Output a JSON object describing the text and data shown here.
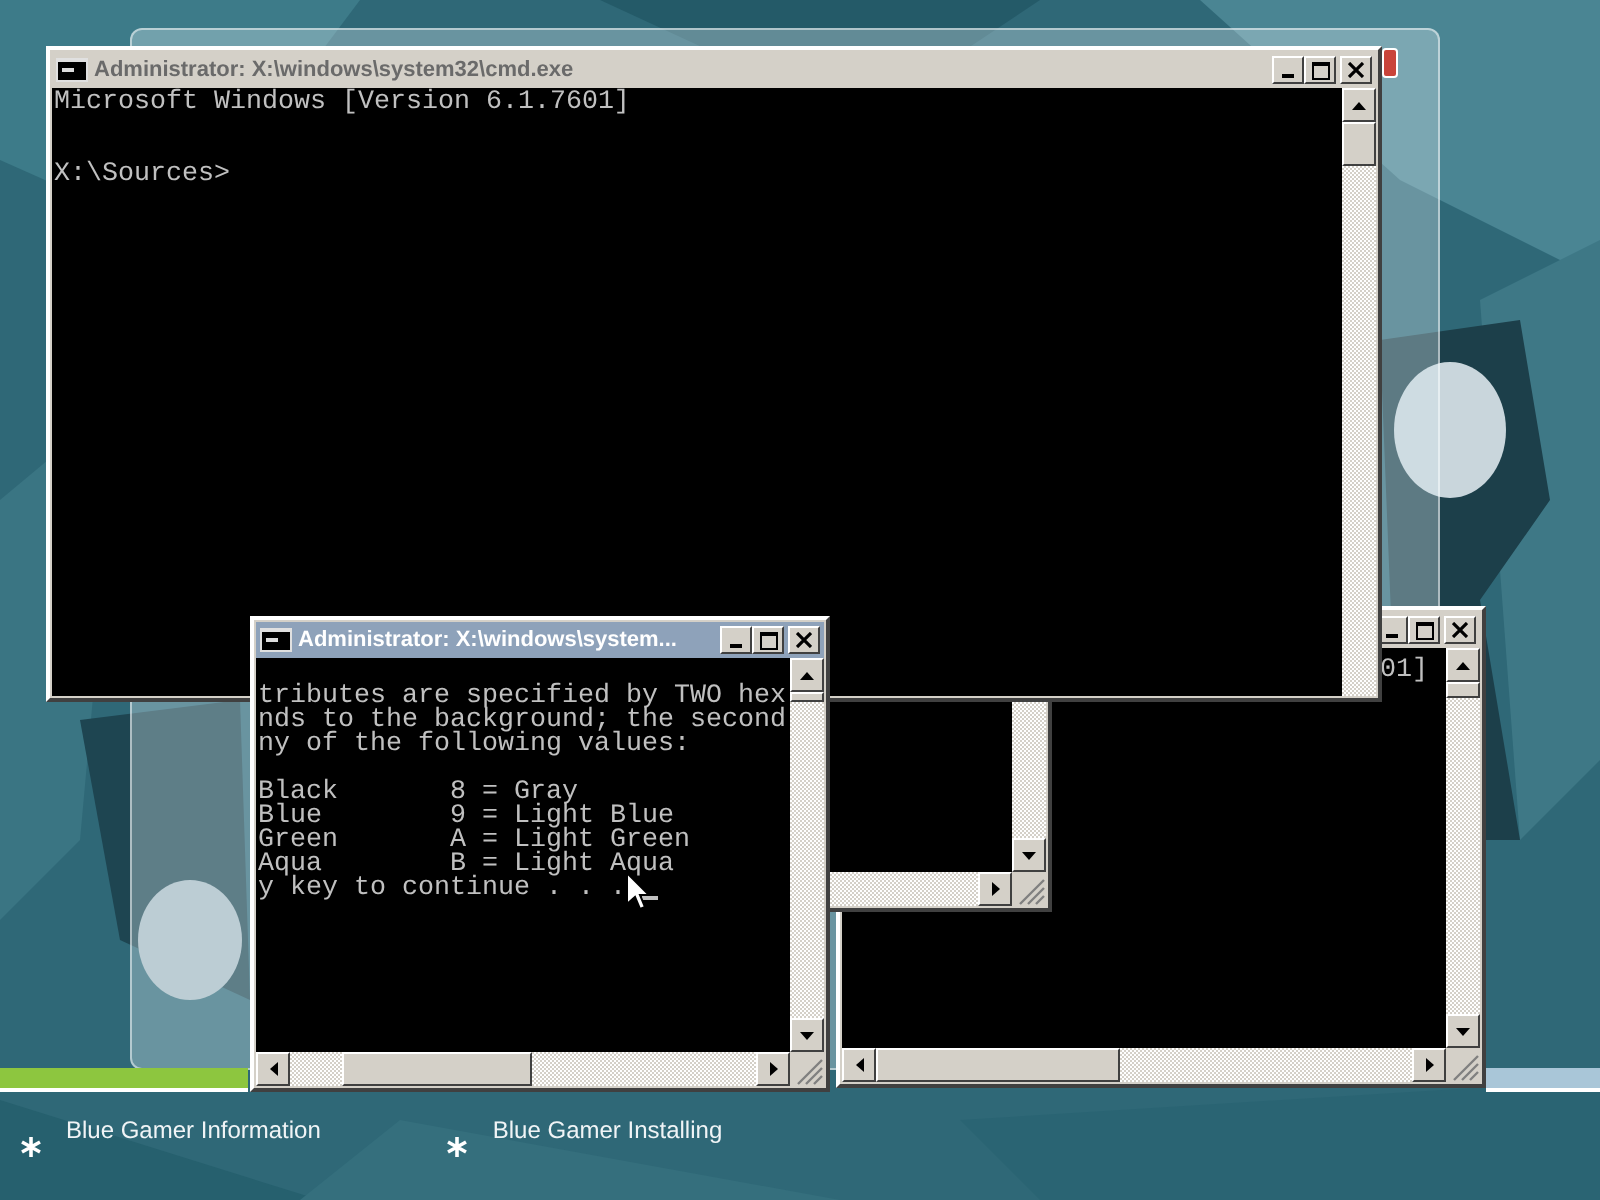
{
  "windows": [
    {
      "kind": "console",
      "title": "Administrator: X:\\windows\\system32\\cmd.exe",
      "active": false,
      "blocks": [
        [
          "Microsoft Windows [Version 6.1.7601]"
        ],
        [
          "X:\\Sources>"
        ]
      ]
    },
    {
      "kind": "console",
      "title": "Administrator: X:\\windows\\system...",
      "active": true,
      "text_cursor": true,
      "blocks": [
        [
          "tributes are specified by TWO hex",
          "nds to the background; the second",
          "ny of the following values:"
        ],
        [
          "Black       8 = Gray",
          "Blue        9 = Light Blue",
          "Green       A = Light Green",
          "Aqua        B = Light Aqua",
          "y key to continue . . ."
        ]
      ]
    },
    {
      "kind": "frame"
    },
    {
      "kind": "console",
      "active": false,
      "blocks": [
        [
          "01]"
        ]
      ]
    }
  ],
  "progress": {
    "level": 0.155
  },
  "status_items": [
    {
      "label": "Blue Gamer Information"
    },
    {
      "label": "Blue Gamer Installing"
    }
  ]
}
